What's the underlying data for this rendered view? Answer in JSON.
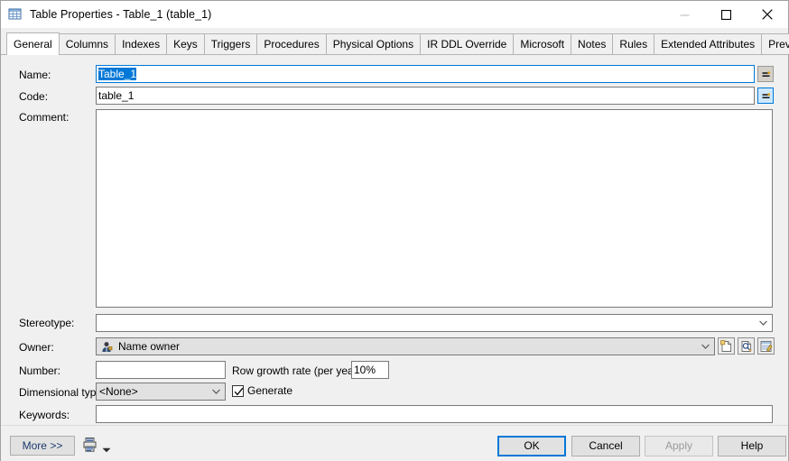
{
  "window": {
    "title": "Table Properties - Table_1 (table_1)",
    "icon": "table-grid-icon",
    "controls": {
      "minimize": "minimize-icon",
      "maximize": "maximize-icon",
      "close": "close-icon"
    },
    "accent_color": "#0078d7",
    "background_color": "#f0f0f0"
  },
  "tabs": [
    {
      "label": "General",
      "active": true
    },
    {
      "label": "Columns",
      "active": false
    },
    {
      "label": "Indexes",
      "active": false
    },
    {
      "label": "Keys",
      "active": false
    },
    {
      "label": "Triggers",
      "active": false
    },
    {
      "label": "Procedures",
      "active": false
    },
    {
      "label": "Physical Options",
      "active": false
    },
    {
      "label": "IR DDL Override",
      "active": false
    },
    {
      "label": "Microsoft",
      "active": false
    },
    {
      "label": "Notes",
      "active": false
    },
    {
      "label": "Rules",
      "active": false
    },
    {
      "label": "Extended Attributes",
      "active": false
    },
    {
      "label": "Preview",
      "active": false
    }
  ],
  "form": {
    "name": {
      "label": "Name:",
      "value": "Table_1",
      "selected": true,
      "focused": true,
      "equals_button": "="
    },
    "code": {
      "label": "Code:",
      "value": "table_1",
      "equals_button": "=",
      "equals_button_highlighted": true
    },
    "comment": {
      "label": "Comment:",
      "value": ""
    },
    "stereotype": {
      "label": "Stereotype:",
      "value": ""
    },
    "owner": {
      "label": "Owner:",
      "value": "Name owner",
      "icon": "user-icon",
      "actions": [
        "new-owner-icon",
        "browse-owner-icon",
        "owner-properties-icon"
      ]
    },
    "number": {
      "label": "Number:",
      "value": ""
    },
    "row_growth_rate": {
      "label": "Row growth rate (per year):",
      "value": "10%"
    },
    "dimensional_type": {
      "label": "Dimensional type:",
      "value": "<None>",
      "options": [
        "<None>"
      ]
    },
    "generate": {
      "label": "Generate",
      "checked": true
    },
    "keywords": {
      "label": "Keywords:",
      "value": ""
    }
  },
  "footer": {
    "more": "More >>",
    "print_icon": "print-icon",
    "print_caret": "chevron-down-icon",
    "ok": "OK",
    "cancel": "Cancel",
    "apply": "Apply",
    "apply_disabled": true,
    "help": "Help"
  }
}
